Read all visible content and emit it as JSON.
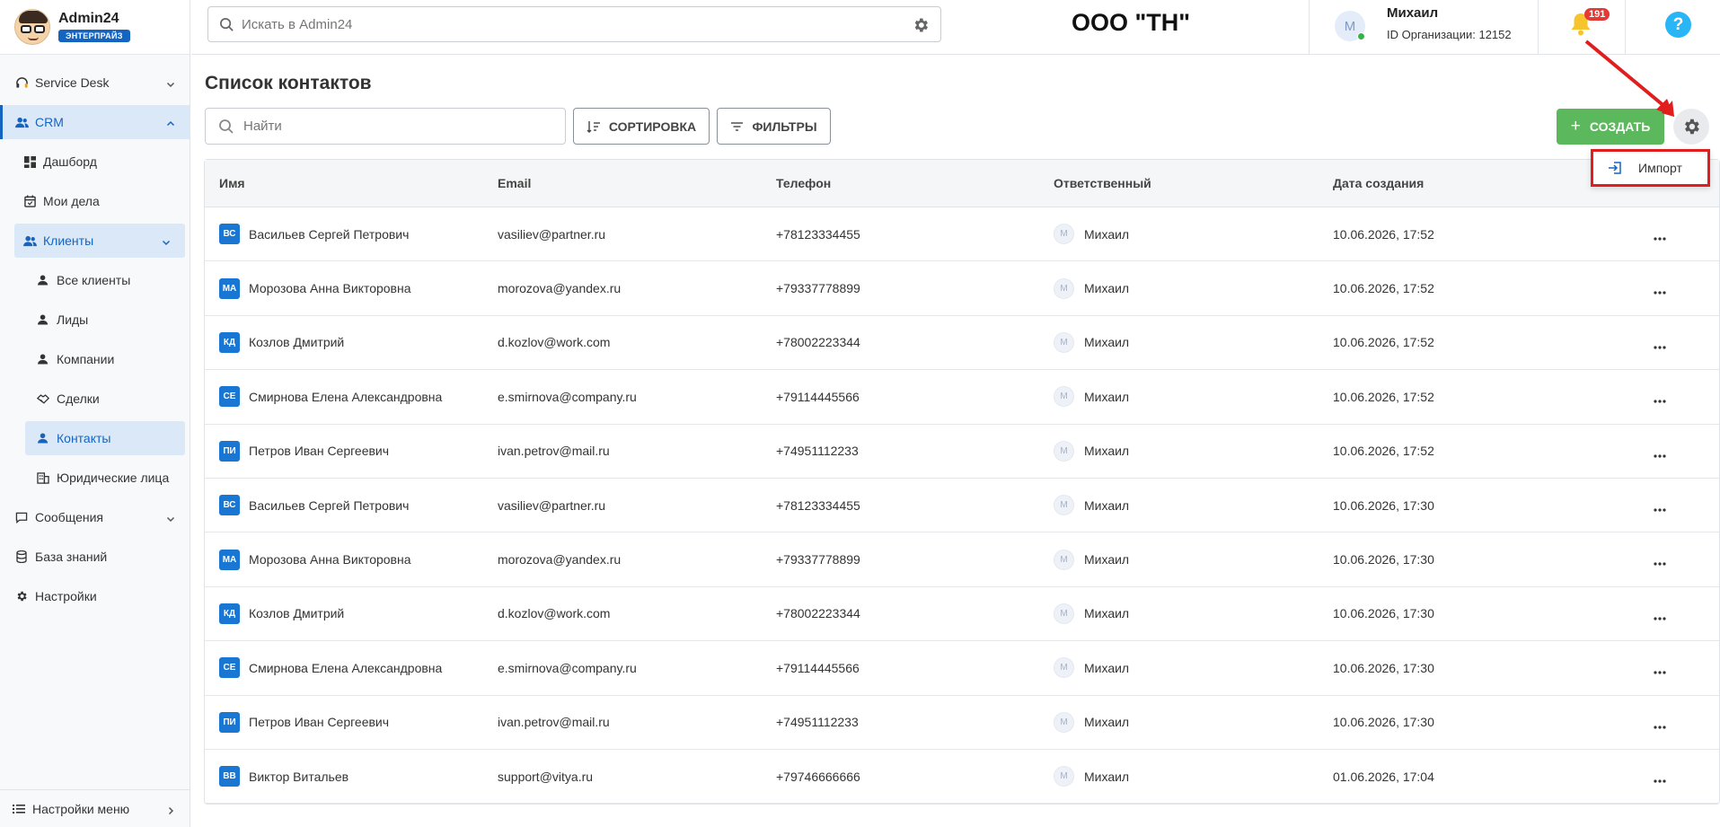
{
  "brand": {
    "name": "Admin24",
    "badge": "ЭНТЕРПРАЙЗ"
  },
  "sidebar": {
    "items": [
      {
        "label": "Service Desk",
        "icon": "headset-icon"
      },
      {
        "label": "CRM",
        "icon": "users-icon"
      },
      {
        "label": "Дашборд",
        "icon": "dashboard-icon"
      },
      {
        "label": "Мои дела",
        "icon": "calendar-icon"
      },
      {
        "label": "Клиенты",
        "icon": "users-icon"
      },
      {
        "label": "Все клиенты",
        "icon": "person-icon"
      },
      {
        "label": "Лиды",
        "icon": "person-icon"
      },
      {
        "label": "Компании",
        "icon": "person-icon"
      },
      {
        "label": "Сделки",
        "icon": "handshake-icon"
      },
      {
        "label": "Контакты",
        "icon": "person-icon"
      },
      {
        "label": "Юридические лица",
        "icon": "building-icon"
      },
      {
        "label": "Сообщения",
        "icon": "chat-icon"
      },
      {
        "label": "База знаний",
        "icon": "database-icon"
      },
      {
        "label": "Настройки",
        "icon": "gear-icon"
      }
    ],
    "footer": "Настройки меню"
  },
  "header": {
    "search_placeholder": "Искать в Admin24",
    "org_name": "ООО \"ТН\"",
    "user_initial": "М",
    "user_name": "Михаил",
    "user_org": "ID Организации: 12152",
    "notifications": "191",
    "help": "?"
  },
  "main": {
    "title": "Список контактов",
    "find_placeholder": "Найти",
    "sort_label": "СОРТИРОВКА",
    "filter_label": "ФИЛЬТРЫ",
    "create_label": "СОЗДАТЬ",
    "import_label": "Импорт"
  },
  "table": {
    "columns": [
      "Имя",
      "Email",
      "Телефон",
      "Ответственный",
      "Дата создания"
    ],
    "rows": [
      {
        "initials": "ВС",
        "name": "Васильев Сергей Петрович",
        "email": "vasiliev@partner.ru",
        "phone": "+78123334455",
        "resp": "Михаил",
        "resp_initial": "М",
        "date": "10.06.2026, 17:52"
      },
      {
        "initials": "МА",
        "name": "Морозова Анна Викторовна",
        "email": "morozova@yandex.ru",
        "phone": "+79337778899",
        "resp": "Михаил",
        "resp_initial": "М",
        "date": "10.06.2026, 17:52"
      },
      {
        "initials": "КД",
        "name": "Козлов Дмитрий",
        "email": "d.kozlov@work.com",
        "phone": "+78002223344",
        "resp": "Михаил",
        "resp_initial": "М",
        "date": "10.06.2026, 17:52"
      },
      {
        "initials": "СЕ",
        "name": "Смирнова Елена Александровна",
        "email": "e.smirnova@company.ru",
        "phone": "+79114445566",
        "resp": "Михаил",
        "resp_initial": "М",
        "date": "10.06.2026, 17:52"
      },
      {
        "initials": "ПИ",
        "name": "Петров Иван Сергеевич",
        "email": "ivan.petrov@mail.ru",
        "phone": "+74951112233",
        "resp": "Михаил",
        "resp_initial": "М",
        "date": "10.06.2026, 17:52"
      },
      {
        "initials": "ВС",
        "name": "Васильев Сергей Петрович",
        "email": "vasiliev@partner.ru",
        "phone": "+78123334455",
        "resp": "Михаил",
        "resp_initial": "М",
        "date": "10.06.2026, 17:30"
      },
      {
        "initials": "МА",
        "name": "Морозова Анна Викторовна",
        "email": "morozova@yandex.ru",
        "phone": "+79337778899",
        "resp": "Михаил",
        "resp_initial": "М",
        "date": "10.06.2026, 17:30"
      },
      {
        "initials": "КД",
        "name": "Козлов Дмитрий",
        "email": "d.kozlov@work.com",
        "phone": "+78002223344",
        "resp": "Михаил",
        "resp_initial": "М",
        "date": "10.06.2026, 17:30"
      },
      {
        "initials": "СЕ",
        "name": "Смирнова Елена Александровна",
        "email": "e.smirnova@company.ru",
        "phone": "+79114445566",
        "resp": "Михаил",
        "resp_initial": "М",
        "date": "10.06.2026, 17:30"
      },
      {
        "initials": "ПИ",
        "name": "Петров Иван Сергеевич",
        "email": "ivan.petrov@mail.ru",
        "phone": "+74951112233",
        "resp": "Михаил",
        "resp_initial": "М",
        "date": "10.06.2026, 17:30"
      },
      {
        "initials": "ВВ",
        "name": "Виктор Витальев",
        "email": "support@vitya.ru",
        "phone": "+79746666666",
        "resp": "Михаил",
        "resp_initial": "М",
        "date": "01.06.2026, 17:04"
      }
    ]
  },
  "colors": {
    "accent": "#1565c0",
    "create": "#5cb85c",
    "highlight": "#e01e1e"
  }
}
